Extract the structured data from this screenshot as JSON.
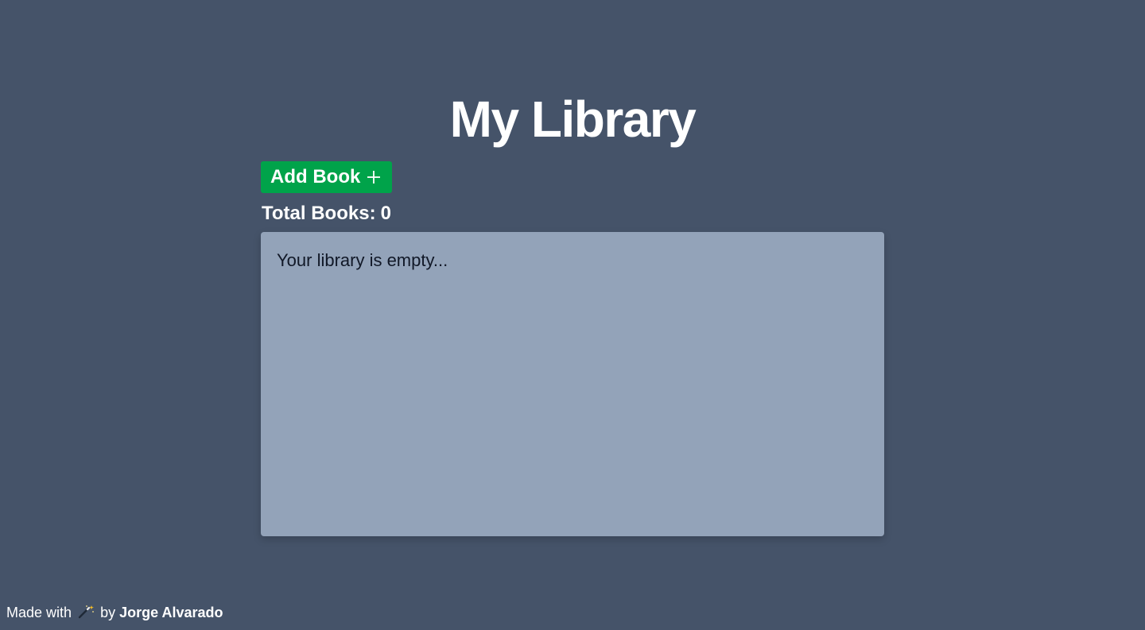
{
  "header": {
    "title": "My Library"
  },
  "toolbar": {
    "add_label": "Add Book",
    "add_icon": "plus-icon"
  },
  "stats": {
    "label": "Total Books:",
    "count": "0"
  },
  "library": {
    "empty_message": "Your library is empty..."
  },
  "footer": {
    "prefix": "Made with",
    "icon": "magic-wand-icon",
    "by": "by",
    "author": "Jorge Alvarado"
  },
  "colors": {
    "background": "#455369",
    "accent": "#00a34a",
    "panel": "#93a3b9",
    "panel_text": "#111827"
  }
}
